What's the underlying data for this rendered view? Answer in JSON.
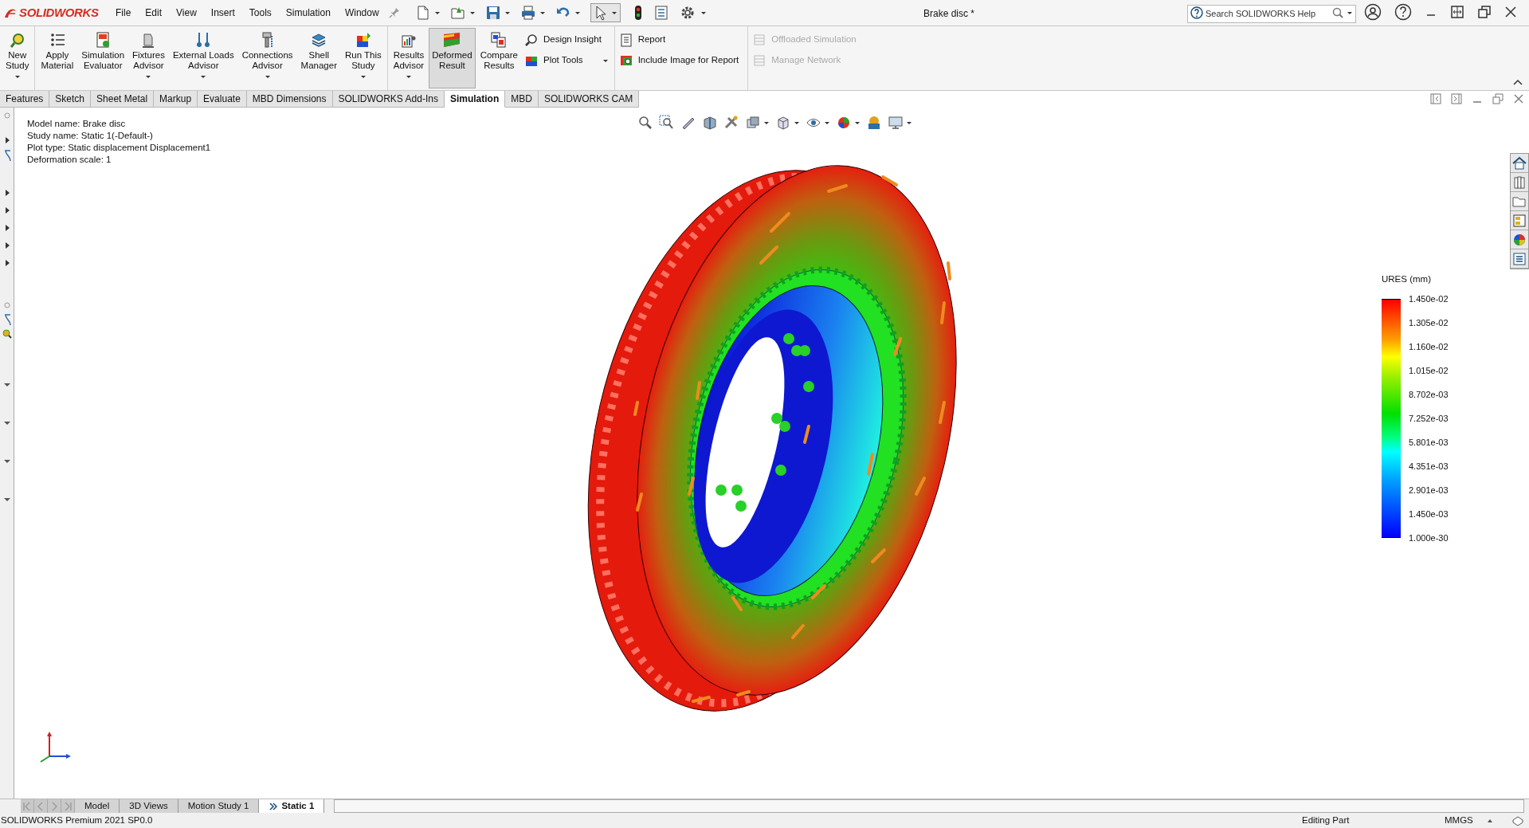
{
  "app": {
    "logo": "SOLIDWORKS"
  },
  "menu": [
    "File",
    "Edit",
    "View",
    "Insert",
    "Tools",
    "Simulation",
    "Window"
  ],
  "title": "Brake disc *",
  "search": {
    "placeholder": "Search SOLIDWORKS Help"
  },
  "ribbon": {
    "groups": [
      {
        "large": [
          {
            "lines": [
              "New",
              "Study"
            ],
            "dropdown": true,
            "selected": false
          }
        ]
      },
      {
        "large": [
          {
            "lines": [
              "Apply",
              "Material"
            ],
            "dropdown": false,
            "selected": false
          },
          {
            "lines": [
              "Simulation",
              "Evaluator"
            ],
            "dropdown": false,
            "selected": false
          },
          {
            "lines": [
              "Fixtures",
              "Advisor"
            ],
            "dropdown": true,
            "selected": false
          },
          {
            "lines": [
              "External Loads",
              "Advisor"
            ],
            "dropdown": true,
            "selected": false
          },
          {
            "lines": [
              "Connections",
              "Advisor"
            ],
            "dropdown": true,
            "selected": false
          },
          {
            "lines": [
              "Shell",
              "Manager"
            ],
            "dropdown": false,
            "selected": false
          },
          {
            "lines": [
              "Run This",
              "Study"
            ],
            "dropdown": true,
            "selected": false
          }
        ]
      },
      {
        "large": [
          {
            "lines": [
              "Results",
              "Advisor"
            ],
            "dropdown": true,
            "selected": false
          },
          {
            "lines": [
              "Deformed",
              "Result"
            ],
            "dropdown": false,
            "selected": true
          },
          {
            "lines": [
              "Compare",
              "Results"
            ],
            "dropdown": false,
            "selected": false
          }
        ],
        "small": [
          {
            "label": "Design Insight",
            "dropdown": false,
            "disabled": false
          },
          {
            "label": "Plot Tools",
            "dropdown": true,
            "disabled": false
          }
        ]
      },
      {
        "small": [
          {
            "label": "Report",
            "dropdown": false,
            "disabled": false
          },
          {
            "label": "Include Image for Report",
            "dropdown": false,
            "disabled": false
          }
        ]
      },
      {
        "small": [
          {
            "label": "Offloaded Simulation",
            "dropdown": false,
            "disabled": true
          },
          {
            "label": "Manage Network",
            "dropdown": false,
            "disabled": true
          }
        ]
      }
    ]
  },
  "command_tabs": [
    {
      "label": "Features",
      "selected": false
    },
    {
      "label": "Sketch",
      "selected": false
    },
    {
      "label": "Sheet Metal",
      "selected": false
    },
    {
      "label": "Markup",
      "selected": false
    },
    {
      "label": "Evaluate",
      "selected": false
    },
    {
      "label": "MBD Dimensions",
      "selected": false
    },
    {
      "label": "SOLIDWORKS Add-Ins",
      "selected": false
    },
    {
      "label": "Simulation",
      "selected": true
    },
    {
      "label": "MBD",
      "selected": false
    },
    {
      "label": "SOLIDWORKS CAM",
      "selected": false
    }
  ],
  "model_info": [
    "Model name: Brake disc",
    "Study name: Static 1(-Default-)",
    "Plot type: Static displacement Displacement1",
    "Deformation scale: 1"
  ],
  "legend": {
    "title": "URES (mm)",
    "labels": [
      "1.450e-02",
      "1.305e-02",
      "1.160e-02",
      "1.015e-02",
      "8.702e-03",
      "7.252e-03",
      "5.801e-03",
      "4.351e-03",
      "2.901e-03",
      "1.450e-03",
      "1.000e-30"
    ]
  },
  "bottom_tabs": [
    {
      "label": "Model",
      "selected": false
    },
    {
      "label": "3D Views",
      "selected": false
    },
    {
      "label": "Motion Study 1",
      "selected": false
    },
    {
      "label": "Static 1",
      "selected": true
    }
  ],
  "status_bar": {
    "product": "SOLIDWORKS Premium 2021 SP0.0",
    "mode": "Editing Part",
    "units": "MMGS"
  }
}
